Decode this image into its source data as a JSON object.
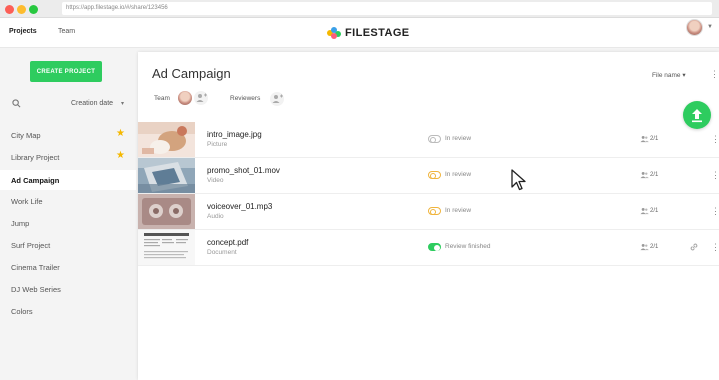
{
  "browser": {
    "url": "https://app.filestage.io/#/share/123456"
  },
  "nav": {
    "projects_label": "Projects",
    "team_label": "Team",
    "logo_text": "FILESTAGE"
  },
  "sidebar": {
    "create_label": "CREATE PROJECT",
    "sort_label": "Creation date",
    "projects": [
      {
        "label": "City Map",
        "starred": true
      },
      {
        "label": "Library Project",
        "starred": true
      },
      {
        "label": "Ad Campaign",
        "active": true
      },
      {
        "label": "Work Life"
      },
      {
        "label": "Jump"
      },
      {
        "label": "Surf Project"
      },
      {
        "label": "Cinema Trailer"
      },
      {
        "label": "DJ Web Series"
      },
      {
        "label": "Colors"
      }
    ]
  },
  "main": {
    "title": "Ad Campaign",
    "sort_label": "File name",
    "team_label": "Team",
    "reviewers_label": "Reviewers",
    "files": [
      {
        "name": "intro_image.jpg",
        "type": "Picture",
        "status": "In review",
        "status_color": "grey",
        "count": "2/1"
      },
      {
        "name": "promo_shot_01.mov",
        "type": "Video",
        "status": "In review",
        "status_color": "amber",
        "count": "2/1"
      },
      {
        "name": "voiceover_01.mp3",
        "type": "Audio",
        "status": "In review",
        "status_color": "amber",
        "count": "2/1"
      },
      {
        "name": "concept.pdf",
        "type": "Document",
        "status": "Review finished",
        "status_color": "green",
        "count": "2/1"
      }
    ]
  },
  "colors": {
    "accent": "#2ecc5f",
    "star": "#f5b800",
    "amber": "#f0b43c"
  },
  "icons": [
    "search-icon",
    "upload-icon",
    "add-person-icon",
    "people-icon",
    "link-icon",
    "kebab-menu-icon",
    "star-icon",
    "chevron-down-icon"
  ]
}
